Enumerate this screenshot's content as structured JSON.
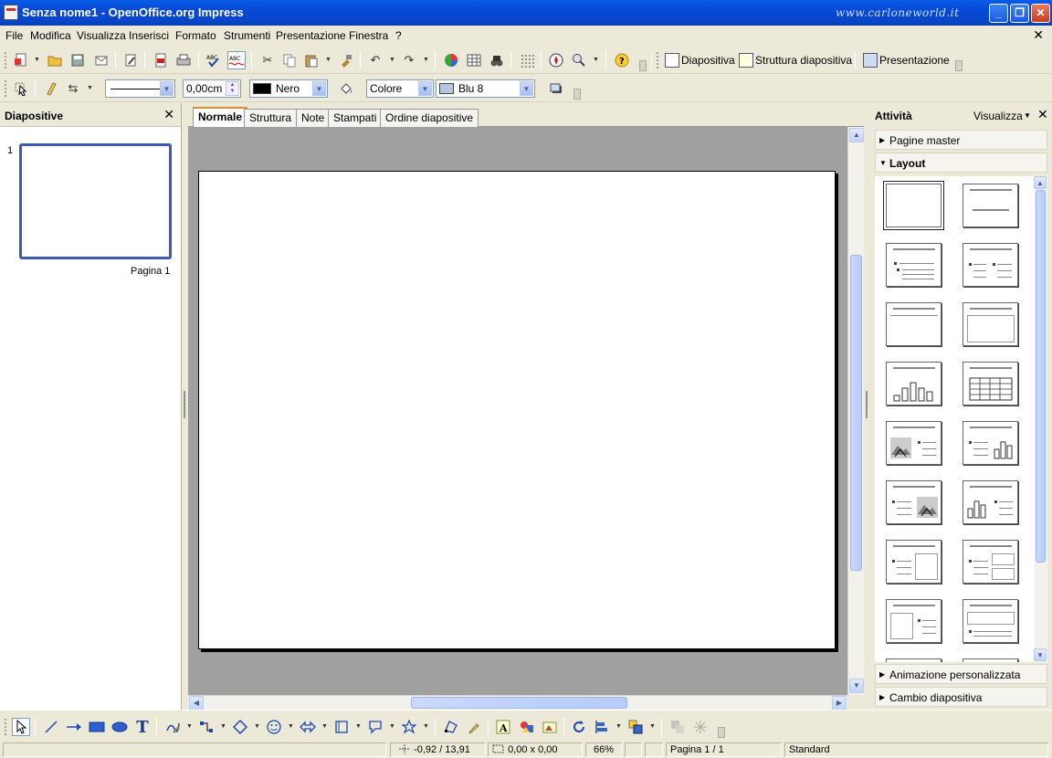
{
  "window": {
    "title": "Senza nome1 - OpenOffice.org Impress",
    "watermark": "www.carloneworld.it",
    "min_label": "_",
    "max_label": "❐",
    "close_label": "✕"
  },
  "menu": [
    "File",
    "Modifica",
    "Visualizza",
    "Inserisci",
    "Formato",
    "Strumenti",
    "Presentazione",
    "Finestra",
    "?"
  ],
  "menu_close": "✕",
  "toolbar": {
    "slide_btn": "Diapositiva",
    "layout_btn": "Struttura diapositiva",
    "present_btn": "Presentazione"
  },
  "line_toolbar": {
    "line_width": "0,00cm",
    "line_color": "Nero",
    "line_color_hex": "#000000",
    "fill_type": "Colore",
    "fill_color": "Blu 8",
    "fill_color_hex": "#b4c7dc"
  },
  "slides_panel": {
    "title": "Diapositive",
    "close": "✕",
    "slides": [
      {
        "number": "1",
        "label": "Pagina 1"
      }
    ]
  },
  "view_tabs": [
    "Normale",
    "Struttura",
    "Note",
    "Stampati",
    "Ordine diapositive"
  ],
  "tasks_panel": {
    "title": "Attività",
    "view_menu": "Visualizza",
    "close": "✕",
    "sections": {
      "master": "Pagine master",
      "layout": "Layout",
      "animation": "Animazione personalizzata",
      "transition": "Cambio diapositiva"
    }
  },
  "status": {
    "position": "-0,92 / 13,91",
    "size": "0,00 x 0,00",
    "zoom": "66%",
    "page": "Pagina 1 / 1",
    "layout": "Standard"
  }
}
